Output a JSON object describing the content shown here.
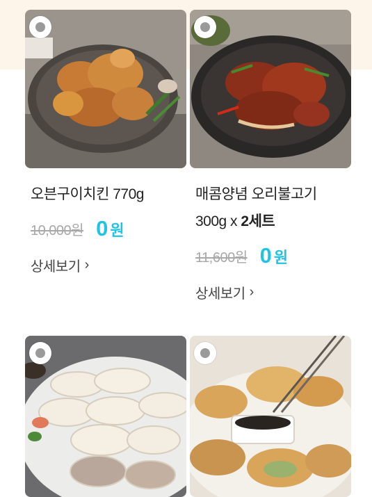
{
  "products": [
    {
      "name": "오븐구이치킨 770g",
      "name_rest": "",
      "name_bold": "",
      "original_price": "10,000원",
      "sale_price": "0",
      "sale_unit": "원",
      "detail_label": "상세보기",
      "image": "oven-roasted-chicken-photo"
    },
    {
      "name": "매콤양념 오리불고기",
      "name_rest": "300g x ",
      "name_bold": "2세트",
      "original_price": "11,600원",
      "sale_price": "0",
      "sale_unit": "원",
      "detail_label": "상세보기",
      "image": "spicy-duck-bulgogi-photo"
    },
    {
      "name": "",
      "image": "steamed-dumplings-photo"
    },
    {
      "name": "",
      "image": "pan-fried-dumplings-photo"
    }
  ],
  "colors": {
    "accent": "#1fc3e3",
    "strike": "#a8a8a8",
    "top_band": "#fdf4ea"
  },
  "icons": {
    "chevron": "chevron-right-icon",
    "select": "radio-select-icon"
  }
}
